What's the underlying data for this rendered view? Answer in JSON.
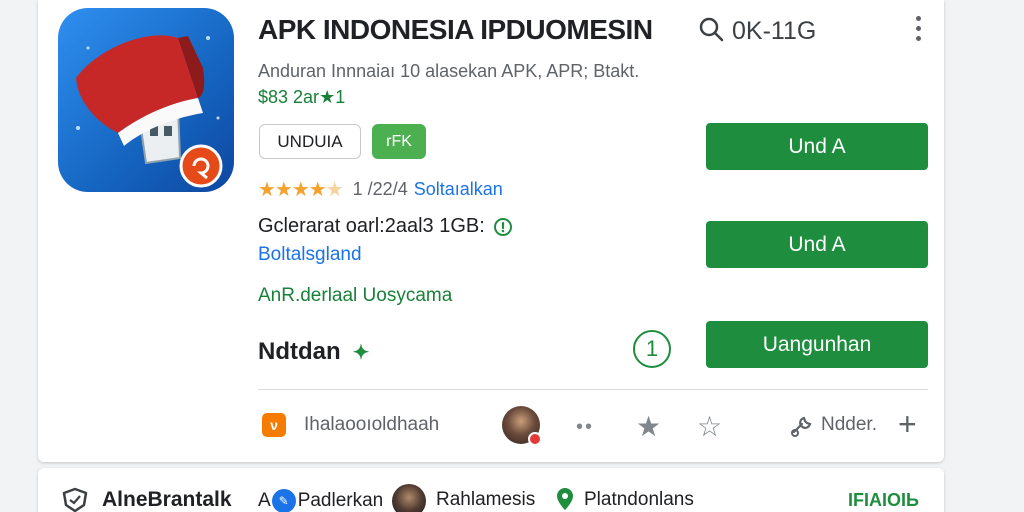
{
  "app": {
    "title": "APK INDONESIA IPDUOMESIN",
    "search_text": "0K-11G",
    "subtitle": "Anduran Innnaiaı 10 alasekan APK, APR; Btakt.",
    "price_text": "$83 2ar",
    "price_star": "★1",
    "chip_outline": "UNDUIA",
    "chip_green": "rFK",
    "rating_stars": "★★★★",
    "rating_dim_star": "★",
    "rating_count": "1 /22/4",
    "rating_link": "Soltaıalkan",
    "size_text": "Gclerarat oarl:2aal3 1GB:",
    "blue_link": "Boltalsgland",
    "green_text": "AnR.derlaal Uosycama",
    "section_label": "Ndtdan",
    "section_sparkle": "✦",
    "circle_number": "1"
  },
  "buttons": {
    "btn1": "Und A",
    "btn2": "Und A",
    "btn3": "Uangunhan"
  },
  "footer": {
    "badge": "ν",
    "text": "Ihalaooıoldhaah",
    "dots": "••",
    "star_solid": "★",
    "star_outline": "☆",
    "tool_text": "Ndder.",
    "plus": "+"
  },
  "bottom": {
    "title": "AlneBrantalk",
    "item1_prefix": "A",
    "item1_avatar": "✎",
    "item1_text": "Padlerkan",
    "item2": "Rahlamesis",
    "item3": "Platndonlans",
    "link": "IFIAIOIЬ"
  },
  "colors": {
    "accent_green": "#1e8e3e",
    "link_blue": "#1a73e8",
    "star_orange": "#f4a22d",
    "icon_blue": "#1565c0",
    "hat_red": "#c62828"
  }
}
